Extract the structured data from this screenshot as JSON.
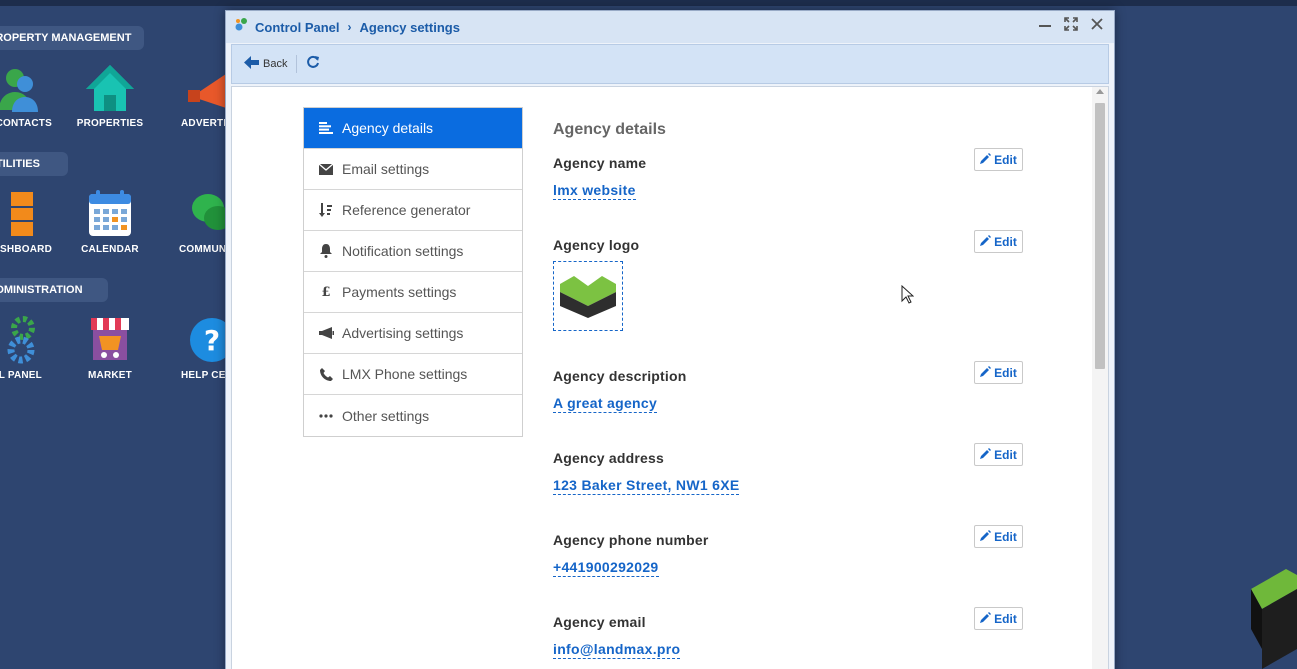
{
  "desktop": {
    "sections": [
      {
        "label": "PROPERTY MANAGEMENT"
      },
      {
        "label": "UTILITIES"
      },
      {
        "label": "ADMINISTRATION"
      }
    ],
    "icons": [
      {
        "label": "CONTACTS"
      },
      {
        "label": "PROPERTIES"
      },
      {
        "label": "ADVERTISING"
      },
      {
        "label": "DASHBOARD"
      },
      {
        "label": "CALENDAR"
      },
      {
        "label": "COMMUNICATIONS"
      },
      {
        "label": "CONTROL PANEL"
      },
      {
        "label": "MARKET"
      },
      {
        "label": "HELP CENTER"
      }
    ]
  },
  "window": {
    "breadcrumb": [
      "Control Panel",
      "Agency settings"
    ],
    "toolbar": {
      "back_label": "Back"
    }
  },
  "menu": {
    "items": [
      {
        "label": "Agency details",
        "icon": "list-icon",
        "active": true
      },
      {
        "label": "Email settings",
        "icon": "envelope-icon"
      },
      {
        "label": "Reference generator",
        "icon": "sort-icon"
      },
      {
        "label": "Notification settings",
        "icon": "bell-icon"
      },
      {
        "label": "Payments settings",
        "icon": "pound-icon"
      },
      {
        "label": "Advertising settings",
        "icon": "megaphone-icon"
      },
      {
        "label": "LMX Phone settings",
        "icon": "phone-icon"
      },
      {
        "label": "Other settings",
        "icon": "ellipsis-icon"
      }
    ]
  },
  "details": {
    "heading": "Agency details",
    "edit_label": "Edit",
    "fields": [
      {
        "label": "Agency name",
        "value": "lmx website"
      },
      {
        "label": "Agency logo",
        "value": ""
      },
      {
        "label": "Agency description",
        "value": "A great agency"
      },
      {
        "label": "Agency address",
        "value": "123 Baker Street, NW1 6XE"
      },
      {
        "label": "Agency phone number",
        "value": "+441900292029"
      },
      {
        "label": "Agency email",
        "value": "info@landmax.pro"
      }
    ]
  },
  "colors": {
    "accent": "#0a6ce0",
    "link": "#1565c8",
    "desktop_bg": "#2e4570"
  }
}
